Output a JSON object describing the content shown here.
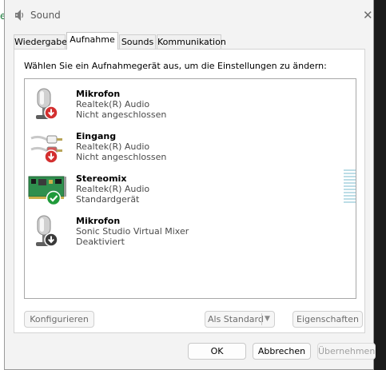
{
  "background": {
    "left_fragment": "er"
  },
  "window": {
    "title": "Sound"
  },
  "tabs": [
    {
      "label": "Wiedergabe"
    },
    {
      "label": "Aufnahme",
      "active": true
    },
    {
      "label": "Sounds"
    },
    {
      "label": "Kommunikation"
    }
  ],
  "instruction": "Wählen Sie ein Aufnahmegerät aus, um die Einstellungen zu ändern:",
  "devices": [
    {
      "name": "Mikrofon",
      "driver": "Realtek(R) Audio",
      "status": "Nicht angeschlossen",
      "icon": "microphone-icon",
      "badge": "red-down-arrow"
    },
    {
      "name": "Eingang",
      "driver": "Realtek(R) Audio",
      "status": "Nicht angeschlossen",
      "icon": "rca-cable-icon",
      "badge": "red-down-arrow"
    },
    {
      "name": "Stereomix",
      "driver": "Realtek(R) Audio",
      "status": "Standardgerät",
      "icon": "sound-card-icon",
      "badge": "green-check"
    },
    {
      "name": "Mikrofon",
      "driver": "Sonic Studio Virtual Mixer",
      "status": "Deaktiviert",
      "icon": "microphone-icon",
      "badge": "black-down-arrow"
    }
  ],
  "buttons": {
    "configure": "Konfigurieren",
    "set_default": "Als Standard",
    "properties": "Eigenschaften",
    "ok": "OK",
    "cancel": "Abbrechen",
    "apply": "Übernehmen"
  },
  "colors": {
    "badge_red": "#d32f2f",
    "badge_green": "#1f9a3a",
    "meter": "#bcdde6"
  }
}
